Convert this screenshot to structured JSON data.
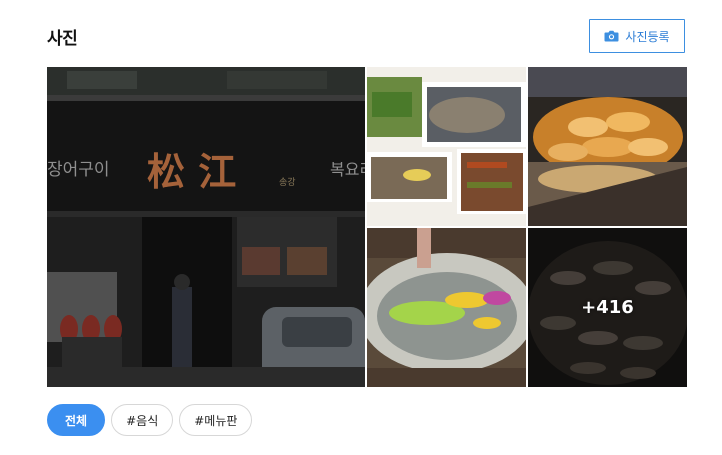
{
  "header": {
    "title": "사진",
    "register_button": {
      "label": "사진등록",
      "icon": "camera-icon"
    }
  },
  "photos": {
    "main_storefront_sign": {
      "left": "장어구이",
      "center": "松 江",
      "small": "송강",
      "right": "복요리"
    },
    "more_count": "+416"
  },
  "filters": [
    {
      "label": "전체",
      "active": true
    },
    {
      "label": "#음식",
      "active": false
    },
    {
      "label": "#메뉴판",
      "active": false
    }
  ],
  "colors": {
    "accent": "#3b8ff0",
    "border": "#d7d7d7"
  }
}
